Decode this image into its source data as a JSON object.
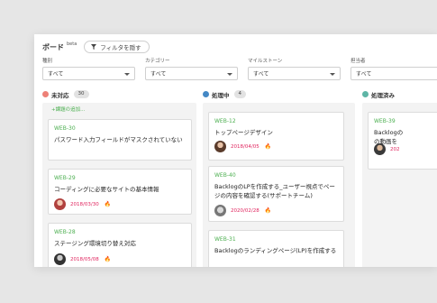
{
  "header": {
    "title": "ボード",
    "beta": "beta",
    "filter_button": "フィルタを隠す"
  },
  "filters": [
    {
      "label": "種別",
      "value": "すべて"
    },
    {
      "label": "カテゴリー",
      "value": "すべて"
    },
    {
      "label": "マイルストーン",
      "value": "すべて"
    },
    {
      "label": "担当者",
      "value": "すべて"
    }
  ],
  "columns": [
    {
      "title": "未対応",
      "count": "30",
      "color": "#ed8077",
      "add_label": "+課題の追加...",
      "cards": [
        {
          "key": "WEB-30",
          "summary": "パスワード入力フィールドがマスクされていない"
        },
        {
          "key": "WEB-29",
          "summary": "コーディングに必要なサイトの基本情報",
          "date": "2018/03/30"
        },
        {
          "key": "WEB-28",
          "summary": "ステージング環境切り替え対応",
          "date": "2018/05/08"
        }
      ]
    },
    {
      "title": "処理中",
      "count": "4",
      "color": "#4488c5",
      "cards": [
        {
          "key": "WEB-12",
          "summary": "トップページデザイン",
          "date": "2018/04/05"
        },
        {
          "key": "WEB-40",
          "summary": "BacklogのLPを作成する_ユーザー視点でページの内容を確認する(サポートチーム)",
          "date": "2020/02/28"
        },
        {
          "key": "WEB-31",
          "summary": "Backlogのランディングページ(LP)を作成する"
        }
      ]
    },
    {
      "title": "処理済み",
      "color": "#5eb5a6",
      "cards": [
        {
          "key": "WEB-39",
          "summary": "Backlogの の動画を",
          "date": "202"
        }
      ]
    }
  ],
  "icons": {
    "filter": "funnel-icon",
    "due": "fire-icon"
  },
  "colors": {
    "issue_key": "#4caf50",
    "due_date": "#e0245e"
  }
}
